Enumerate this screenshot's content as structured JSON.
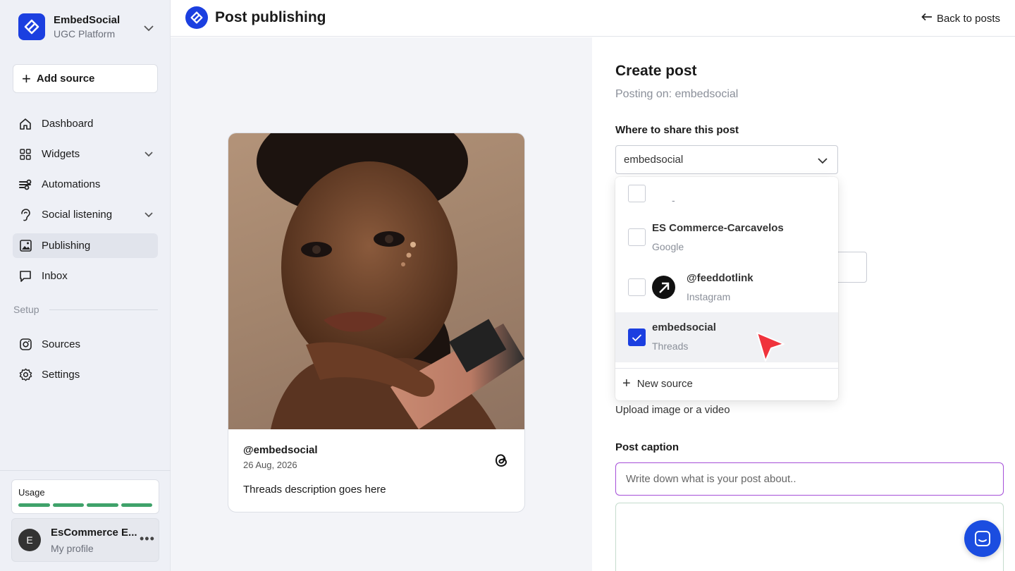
{
  "brand": {
    "name": "EmbedSocial",
    "subtitle": "UGC Platform",
    "accent": "#1b3fe0"
  },
  "sidebar": {
    "add_source_label": "Add source",
    "items": [
      {
        "label": "Dashboard",
        "icon": "home-icon"
      },
      {
        "label": "Widgets",
        "icon": "widgets-icon",
        "expandable": true
      },
      {
        "label": "Automations",
        "icon": "automations-icon"
      },
      {
        "label": "Social listening",
        "icon": "ear-icon",
        "expandable": true
      },
      {
        "label": "Publishing",
        "icon": "image-icon",
        "active": true
      },
      {
        "label": "Inbox",
        "icon": "chat-bubble-icon"
      }
    ],
    "setup_label": "Setup",
    "setup_items": [
      {
        "label": "Sources",
        "icon": "instagram-icon"
      },
      {
        "label": "Settings",
        "icon": "gear-icon"
      }
    ],
    "usage_label": "Usage",
    "usage_segments": 4,
    "usage_color": "#3fa26a",
    "profile": {
      "initial": "E",
      "name": "EsCommerce E...",
      "subtitle": "My profile"
    }
  },
  "header": {
    "title": "Post publishing",
    "back_label": "Back to posts"
  },
  "preview": {
    "username": "@embedsocial",
    "date": "26 Aug, 2026",
    "description": "Threads description goes here"
  },
  "form": {
    "title": "Create post",
    "posting_on": "Posting on: embedsocial",
    "where_label": "Where to share this post",
    "selected_value": "embedsocial",
    "dropdown": {
      "items": [
        {
          "name": "",
          "type": "-",
          "checked": false
        },
        {
          "name": "ES Commerce-Carcavelos",
          "type": "Google",
          "checked": false
        },
        {
          "name": "@feeddotlink",
          "type": "Instagram",
          "checked": false,
          "has_avatar": true
        },
        {
          "name": "embedsocial",
          "type": "Threads",
          "checked": true
        }
      ],
      "new_source_label": "New source"
    },
    "upload_label": "Upload image or a video",
    "caption_label": "Post caption",
    "caption_placeholder": "Write down what is your post about.."
  }
}
